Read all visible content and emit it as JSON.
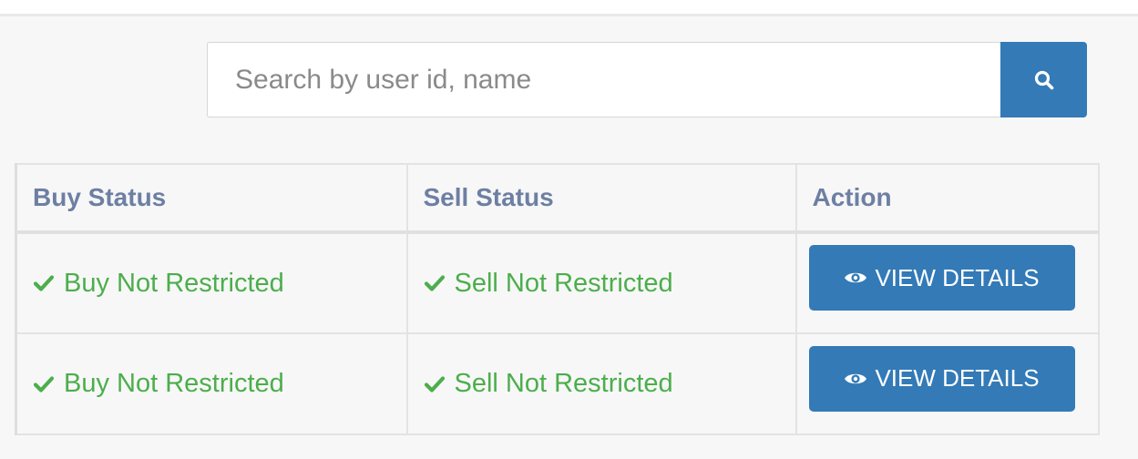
{
  "search": {
    "placeholder": "Search by user id, name",
    "value": "",
    "button_icon": "search-icon"
  },
  "table": {
    "headers": [
      "Buy Status",
      "Sell Status",
      "Action"
    ],
    "rows": [
      {
        "buy_status": "Buy Not Restricted",
        "sell_status": "Sell Not Restricted",
        "action_label": "VIEW DETAILS"
      },
      {
        "buy_status": "Buy Not Restricted",
        "sell_status": "Sell Not Restricted",
        "action_label": "VIEW DETAILS"
      }
    ]
  },
  "colors": {
    "primary": "#337ab7",
    "success": "#4cae4c",
    "header_text": "#6d7fa3"
  },
  "icons": {
    "status": "check-icon",
    "action": "eye-icon"
  }
}
